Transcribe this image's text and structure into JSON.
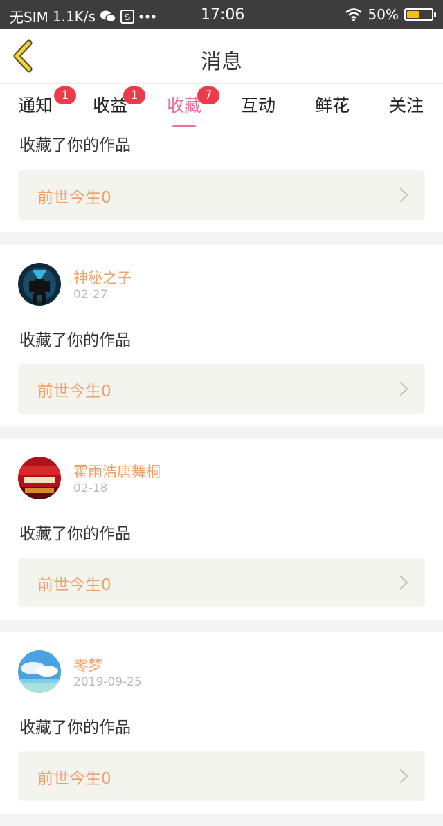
{
  "status_bar": {
    "carrier": "无SIM",
    "speed": "1.1K/s",
    "time": "17:06",
    "battery": "50%",
    "battery_level": 0.5,
    "icons": [
      "wechat-icon",
      "s-app-icon",
      "more-dots-icon",
      "wifi-icon",
      "battery-icon"
    ]
  },
  "header": {
    "title": "消息",
    "back_icon": "chevron-left-icon"
  },
  "tabs": [
    {
      "label": "通知",
      "badge": "1"
    },
    {
      "label": "收益",
      "badge": "1"
    },
    {
      "label": "收藏",
      "badge": "7",
      "active": true
    },
    {
      "label": "互动"
    },
    {
      "label": "鲜花"
    },
    {
      "label": "关注"
    }
  ],
  "colors": {
    "accent": "#ea6f9e",
    "name": "#f0a06a",
    "badge": "#ee3a4a",
    "status_bar": "#3d3d3d"
  },
  "messages": [
    {
      "action": "收藏了你的作品",
      "work": "前世今生0"
    },
    {
      "user": "神秘之子",
      "date": "02-27",
      "action": "收藏了你的作品",
      "work": "前世今生0"
    },
    {
      "user": "霍雨浩唐舞桐",
      "date": "02-18",
      "action": "收藏了你的作品",
      "work": "前世今生0"
    },
    {
      "user": "零梦",
      "date": "2019-09-25",
      "action": "收藏了你的作品",
      "work": "前世今生0"
    }
  ]
}
